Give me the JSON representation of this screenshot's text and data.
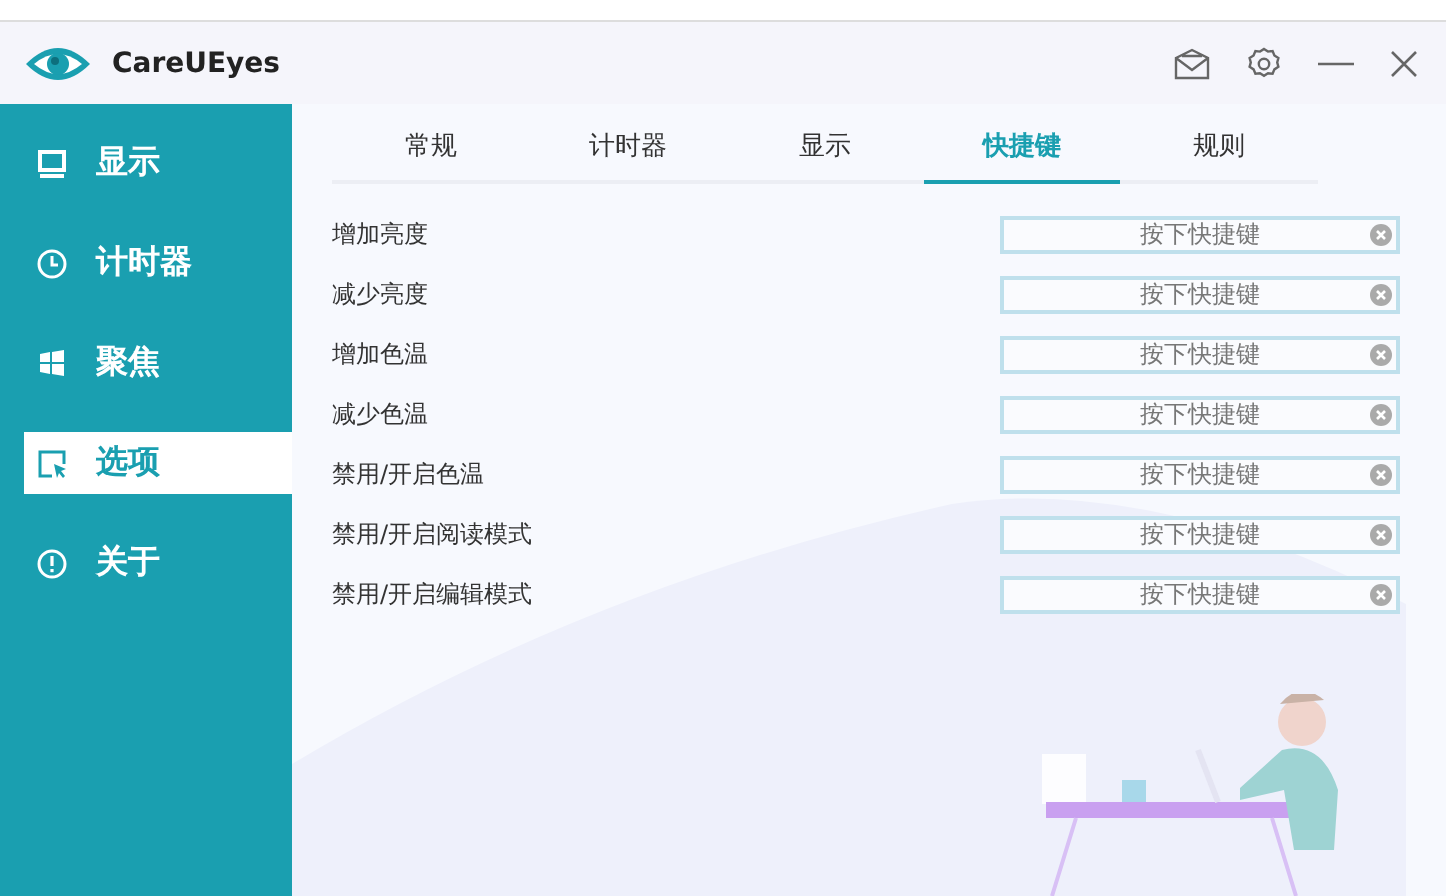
{
  "window": {
    "title": "CareUEyes"
  },
  "sidebar": {
    "items": [
      {
        "label": "显示",
        "selected": false
      },
      {
        "label": "计时器",
        "selected": false
      },
      {
        "label": "聚焦",
        "selected": false
      },
      {
        "label": "选项",
        "selected": true
      },
      {
        "label": "关于",
        "selected": false
      }
    ]
  },
  "tabs": [
    {
      "label": "常规",
      "selected": false
    },
    {
      "label": "计时器",
      "selected": false
    },
    {
      "label": "显示",
      "selected": false
    },
    {
      "label": "快捷键",
      "selected": true
    },
    {
      "label": "规则",
      "selected": false
    }
  ],
  "shortcuts": [
    {
      "label": "增加亮度",
      "placeholder": "按下快捷键"
    },
    {
      "label": "减少亮度",
      "placeholder": "按下快捷键"
    },
    {
      "label": "增加色温",
      "placeholder": "按下快捷键"
    },
    {
      "label": "减少色温",
      "placeholder": "按下快捷键"
    },
    {
      "label": "禁用/开启色温",
      "placeholder": "按下快捷键"
    },
    {
      "label": "禁用/开启阅读模式",
      "placeholder": "按下快捷键"
    },
    {
      "label": "禁用/开启编辑模式",
      "placeholder": "按下快捷键"
    }
  ]
}
